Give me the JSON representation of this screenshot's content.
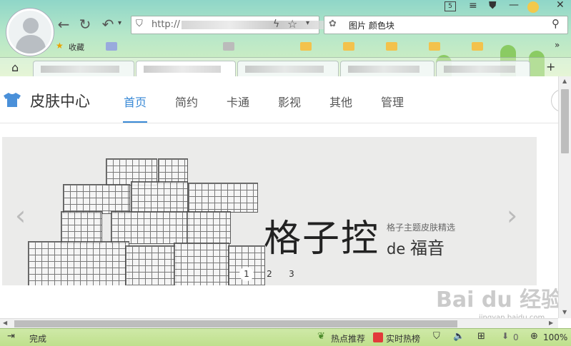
{
  "browser": {
    "url_prefix": "http://",
    "search_text": "图片 颜色块",
    "bookmarks_label": "收藏",
    "tab_badge": "5",
    "new_tab_symbol": "+"
  },
  "page": {
    "brand": "皮肤中心",
    "nav": [
      "首页",
      "简约",
      "卡通",
      "影视",
      "其他",
      "管理"
    ],
    "banner": {
      "title": "格子控",
      "subtitle": "格子主题皮肤精选",
      "de": "de",
      "fuyin": "福音",
      "dots": [
        "1",
        "2",
        "3"
      ]
    }
  },
  "statusbar": {
    "status": "完成",
    "hot_recommend": "热点推荐",
    "realtime_hot": "实时热榜",
    "download_count": "0",
    "zoom": "100%"
  },
  "watermark": {
    "main": "Bai du 经验",
    "sub": "jingyan.baidu.com"
  },
  "colors": {
    "accent": "#3a8ad6",
    "chrome_green": "#b6e7c9",
    "status_green": "#bfe08c"
  }
}
